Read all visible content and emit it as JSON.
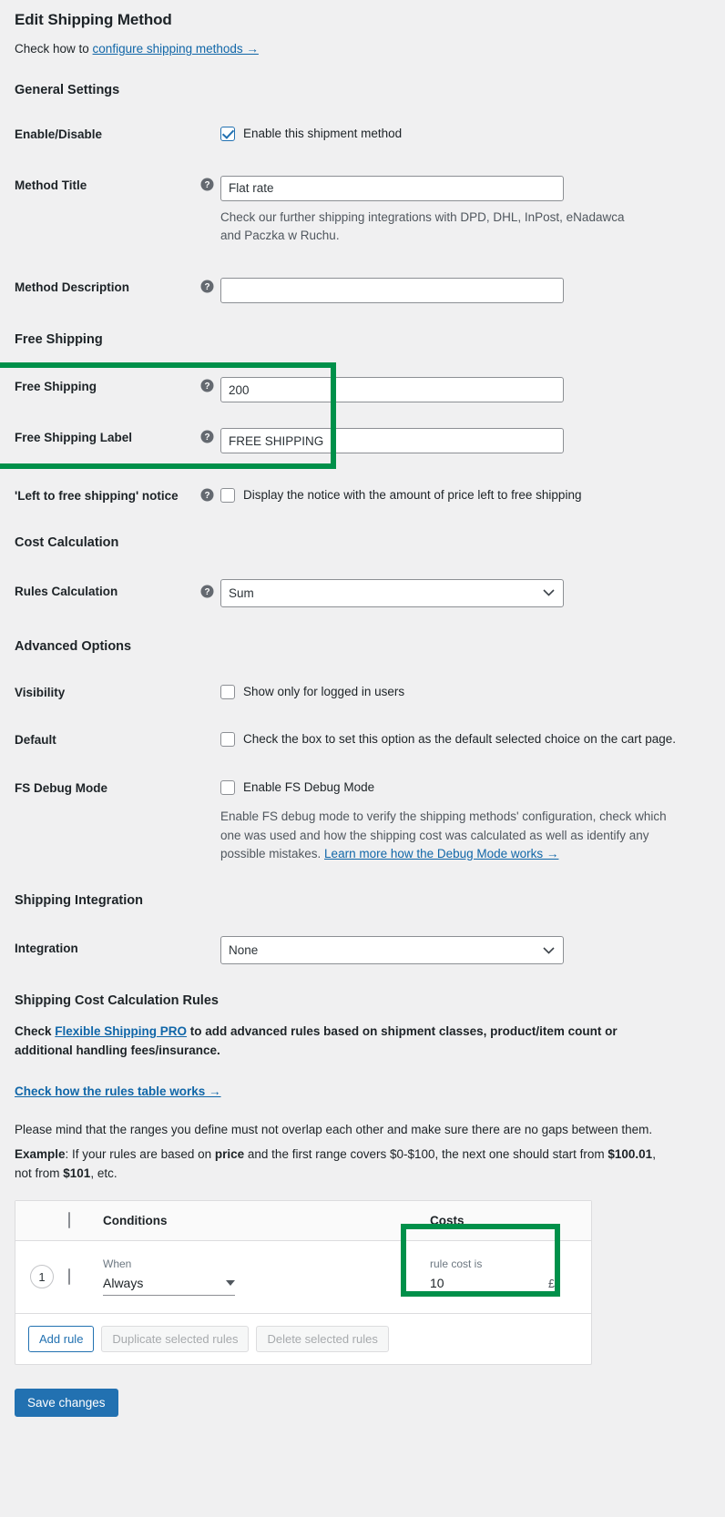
{
  "header": {
    "title": "Edit Shipping Method",
    "subline_prefix": "Check how to ",
    "subline_link": "configure shipping methods →"
  },
  "sections": {
    "general": "General Settings",
    "free_shipping": "Free Shipping",
    "cost_calculation": "Cost Calculation",
    "advanced": "Advanced Options",
    "shipping_integration": "Shipping Integration",
    "rules": "Shipping Cost Calculation Rules"
  },
  "fields": {
    "enable_disable": {
      "label": "Enable/Disable",
      "checkbox_label": "Enable this shipment method",
      "checked": true
    },
    "method_title": {
      "label": "Method Title",
      "value": "Flat rate",
      "description": "Check our further shipping integrations with DPD, DHL, InPost, eNadawca and Paczka w Ruchu."
    },
    "method_description": {
      "label": "Method Description",
      "value": ""
    },
    "free_shipping": {
      "label": "Free Shipping",
      "value": "200"
    },
    "free_shipping_label": {
      "label": "Free Shipping Label",
      "value": "FREE SHIPPING"
    },
    "left_to_free_notice": {
      "label": "'Left to free shipping' notice",
      "checkbox_label": "Display the notice with the amount of price left to free shipping",
      "checked": false
    },
    "rules_calculation": {
      "label": "Rules Calculation",
      "value": "Sum"
    },
    "visibility": {
      "label": "Visibility",
      "checkbox_label": "Show only for logged in users",
      "checked": false
    },
    "default": {
      "label": "Default",
      "checkbox_label": "Check the box to set this option as the default selected choice on the cart page.",
      "checked": false
    },
    "fs_debug_mode": {
      "label": "FS Debug Mode",
      "checkbox_label": "Enable FS Debug Mode",
      "checked": false,
      "description_prefix": "Enable FS debug mode to verify the shipping methods' configuration, check which one was used and how the shipping cost was calculated as well as identify any possible mistakes. ",
      "description_link": "Learn more how the Debug Mode works →"
    },
    "integration": {
      "label": "Integration",
      "value": "None"
    }
  },
  "rules_intro": {
    "check_prefix": "Check ",
    "pro_link": "Flexible Shipping PRO",
    "check_suffix": " to add advanced rules based on shipment classes, product/item count or additional handling fees/insurance.",
    "rules_table_link": "Check how the rules table works →",
    "mind_text": "Please mind that the ranges you define must not overlap each other and make sure there are no gaps between them.",
    "example_label": "Example",
    "example_part1": ": If your rules are based on ",
    "example_bold1": "price",
    "example_part2": " and the first range covers $0-$100, the next one should start from ",
    "example_bold2": "$100.01",
    "example_part3": ", not from ",
    "example_bold3": "$101",
    "example_part4": ", etc."
  },
  "rules_table": {
    "columns": {
      "conditions": "Conditions",
      "costs": "Costs"
    },
    "rows": [
      {
        "number": "1",
        "when_label": "When",
        "when_value": "Always",
        "cost_label": "rule cost is",
        "cost_value": "10",
        "currency": "£"
      }
    ],
    "footer": {
      "add_rule": "Add rule",
      "duplicate": "Duplicate selected rules",
      "delete": "Delete selected rules"
    }
  },
  "save_button": "Save changes",
  "colors": {
    "highlight": "#00904a",
    "link": "#1066a8",
    "primary": "#2271b1"
  }
}
